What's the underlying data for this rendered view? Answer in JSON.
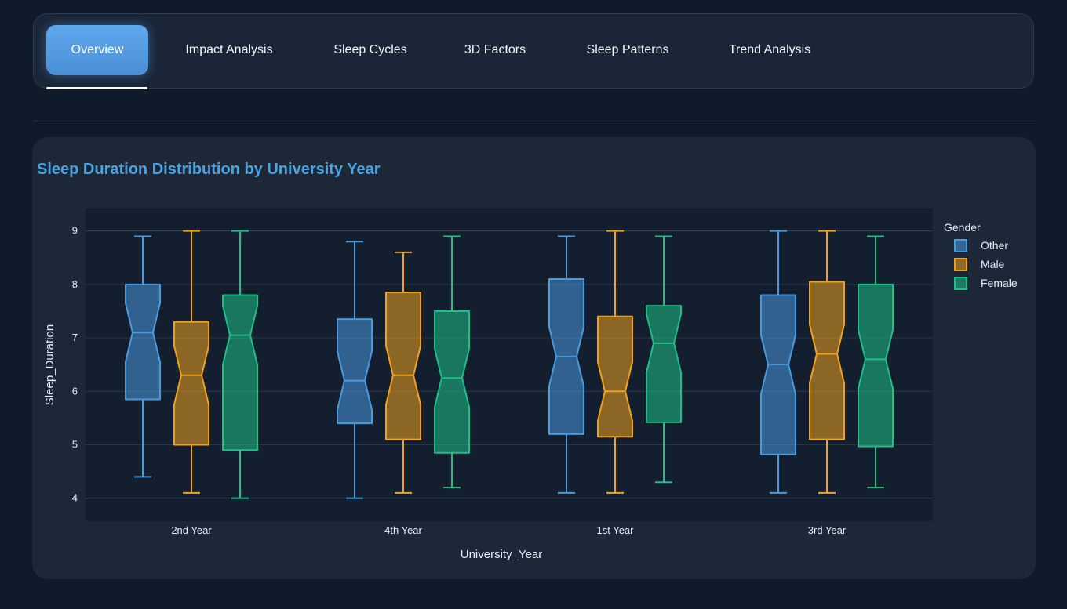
{
  "tabs": [
    {
      "label": "Overview",
      "active": true
    },
    {
      "label": "Impact Analysis",
      "active": false
    },
    {
      "label": "Sleep Cycles",
      "active": false
    },
    {
      "label": "3D Factors",
      "active": false
    },
    {
      "label": "Sleep Patterns",
      "active": false
    },
    {
      "label": "Trend Analysis",
      "active": false
    }
  ],
  "card": {
    "title": "Sleep Duration Distribution by University Year"
  },
  "colors": {
    "accent": "#4aa3e0",
    "Other": "#4a9bde",
    "Male": "#f0a21c",
    "Female": "#1fbf86"
  },
  "chart_data": {
    "type": "box",
    "notched": true,
    "title": "",
    "xlabel": "University_Year",
    "ylabel": "Sleep_Duration",
    "categories": [
      "2nd Year",
      "4th Year",
      "1st Year",
      "3rd Year"
    ],
    "ylim": [
      3.57,
      9.42
    ],
    "yticks": [
      4,
      5,
      6,
      7,
      8,
      9
    ],
    "grid": true,
    "legend": {
      "title": "Gender",
      "position": "right",
      "entries": [
        "Other",
        "Male",
        "Female"
      ]
    },
    "series": [
      {
        "name": "Other",
        "boxes": [
          {
            "min": 4.4,
            "q1": 5.85,
            "median": 7.1,
            "q3": 8.0,
            "max": 8.9
          },
          {
            "min": 4.0,
            "q1": 5.4,
            "median": 6.2,
            "q3": 7.35,
            "max": 8.8
          },
          {
            "min": 4.1,
            "q1": 5.2,
            "median": 6.65,
            "q3": 8.1,
            "max": 8.9
          },
          {
            "min": 4.1,
            "q1": 4.82,
            "median": 6.5,
            "q3": 7.8,
            "max": 9.0
          }
        ]
      },
      {
        "name": "Male",
        "boxes": [
          {
            "min": 4.1,
            "q1": 5.0,
            "median": 6.3,
            "q3": 7.3,
            "max": 9.0
          },
          {
            "min": 4.1,
            "q1": 5.1,
            "median": 6.3,
            "q3": 7.85,
            "max": 8.6
          },
          {
            "min": 4.1,
            "q1": 5.15,
            "median": 6.0,
            "q3": 7.4,
            "max": 9.0
          },
          {
            "min": 4.1,
            "q1": 5.1,
            "median": 6.7,
            "q3": 8.05,
            "max": 9.0
          }
        ]
      },
      {
        "name": "Female",
        "boxes": [
          {
            "min": 4.0,
            "q1": 4.9,
            "median": 7.05,
            "q3": 7.8,
            "max": 9.0
          },
          {
            "min": 4.2,
            "q1": 4.85,
            "median": 6.25,
            "q3": 7.5,
            "max": 8.9
          },
          {
            "min": 4.3,
            "q1": 5.42,
            "median": 6.9,
            "q3": 7.6,
            "max": 8.9
          },
          {
            "min": 4.2,
            "q1": 4.97,
            "median": 6.6,
            "q3": 8.0,
            "max": 8.9
          }
        ]
      }
    ]
  }
}
